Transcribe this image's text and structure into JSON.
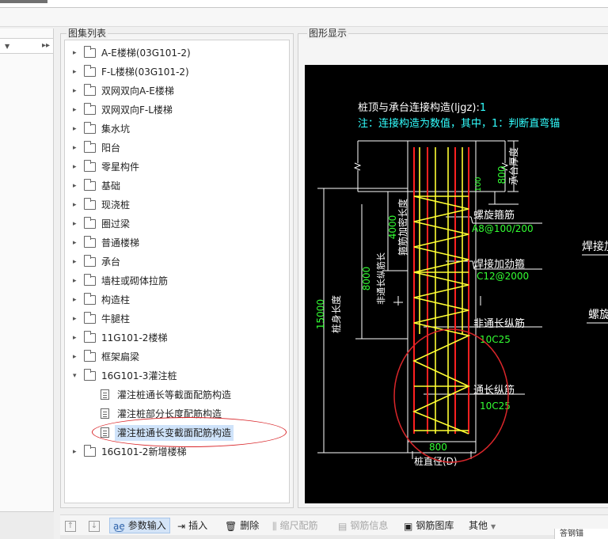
{
  "tree_panel": {
    "title": "图集列表",
    "items": [
      {
        "label": "A-E楼梯(03G101-2)",
        "kind": "folder",
        "expanded": false
      },
      {
        "label": "F-L楼梯(03G101-2)",
        "kind": "folder",
        "expanded": false
      },
      {
        "label": "双网双向A-E楼梯",
        "kind": "folder",
        "expanded": false
      },
      {
        "label": "双网双向F-L楼梯",
        "kind": "folder",
        "expanded": false
      },
      {
        "label": "集水坑",
        "kind": "folder",
        "expanded": false
      },
      {
        "label": "阳台",
        "kind": "folder",
        "expanded": false
      },
      {
        "label": "零星构件",
        "kind": "folder",
        "expanded": false
      },
      {
        "label": "基础",
        "kind": "folder",
        "expanded": false
      },
      {
        "label": "现浇桩",
        "kind": "folder",
        "expanded": false
      },
      {
        "label": "圈过梁",
        "kind": "folder",
        "expanded": false
      },
      {
        "label": "普通楼梯",
        "kind": "folder",
        "expanded": false
      },
      {
        "label": "承台",
        "kind": "folder",
        "expanded": false
      },
      {
        "label": "墙柱或砌体拉筋",
        "kind": "folder",
        "expanded": false
      },
      {
        "label": "构造柱",
        "kind": "folder",
        "expanded": false
      },
      {
        "label": "牛腿柱",
        "kind": "folder",
        "expanded": false
      },
      {
        "label": "11G101-2楼梯",
        "kind": "folder",
        "expanded": false
      },
      {
        "label": "框架扁梁",
        "kind": "folder",
        "expanded": false
      },
      {
        "label": "16G101-3灌注桩",
        "kind": "folder",
        "expanded": true
      },
      {
        "label": "灌注桩通长等截面配筋构造",
        "kind": "doc",
        "selected": false
      },
      {
        "label": "灌注桩部分长度配筋构造",
        "kind": "doc",
        "selected": false
      },
      {
        "label": "灌注桩通长变截面配筋构造",
        "kind": "doc",
        "selected": true
      },
      {
        "label": "16G101-2新增楼梯",
        "kind": "folder",
        "expanded": false
      }
    ]
  },
  "graphics_panel": {
    "title": "图形显示",
    "drawing": {
      "heading_line1_text": "桩顶与承台连接构造(ljgz):",
      "heading_line1_value": "1",
      "heading_line2": "注：连接构造为数值，其中，1：判断直弯锚",
      "cap_thickness_label": "承台厚度",
      "cap_thickness_value": "800",
      "top_offset_value": "100",
      "stirrup_dense_label": "箍筋加密长度",
      "stirrup_dense_value": "4000",
      "partial_bar_label": "非通长纵筋长",
      "partial_bar_value": "8000",
      "pile_length_label": "桩身长度",
      "pile_length_value": "15000",
      "spiral_label": "螺旋箍筋",
      "spiral_value": "A8@100/200",
      "weld_label": "焊接加劲箍",
      "weld_value": "C12@2000",
      "partial_main_label": "非通长纵筋",
      "partial_main_value": "10C25",
      "full_main_label": "通长纵筋",
      "full_main_value": "10C25",
      "diameter_value": "800",
      "diameter_label": "桩直径(D)",
      "right_cut_1": "焊接加",
      "right_cut_2": "螺旋"
    }
  },
  "bottom_toolbar": {
    "param_input": "参数输入",
    "insert": "插入",
    "delete": "删除",
    "scale_rebar": "缩尺配筋",
    "rebar_info": "钢筋信息",
    "rebar_library": "钢筋图库",
    "other": "其他",
    "right_stub": "答钢锚"
  },
  "colors": {
    "canvas_bg": "#000000",
    "rebar_yellow": "#ffff33",
    "rebar_red": "#ff2020",
    "dim_green": "#33ff33",
    "annotation_cyan": "#33ffff",
    "highlight_red": "#d9262a",
    "selection_blue": "#cfe3fa"
  }
}
